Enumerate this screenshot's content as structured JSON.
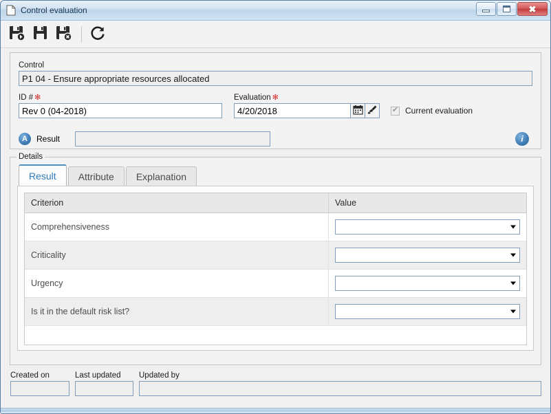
{
  "window": {
    "title": "Control evaluation",
    "icon": "document-icon",
    "buttons": {
      "minimize": "minimize",
      "maximize": "maximize",
      "close": "close"
    }
  },
  "toolbar": {
    "items": [
      {
        "name": "save-new-button",
        "icon": "save-new-icon",
        "tooltip": "Save as new"
      },
      {
        "name": "save-button",
        "icon": "save-icon",
        "tooltip": "Save"
      },
      {
        "name": "save-delete-button",
        "icon": "save-delete-icon",
        "tooltip": "Delete"
      },
      {
        "name": "refresh-button",
        "icon": "refresh-icon",
        "tooltip": "Refresh"
      }
    ]
  },
  "header": {
    "control_label": "Control",
    "control_value": "P1 04 - Ensure appropriate resources allocated",
    "id_label": "ID #",
    "id_required": "✻",
    "id_value": "Rev 0 (04-2018)",
    "evaluation_label": "Evaluation",
    "evaluation_required": "✻",
    "evaluation_value": "4/20/2018",
    "calendar_icon": "calendar-icon",
    "clear_icon": "brush-icon",
    "current_evaluation_label": "Current evaluation",
    "current_evaluation_checked": "✔",
    "result_label": "Result",
    "result_icon_letter": "A",
    "result_value": "",
    "result_placeholder": "",
    "info_icon_letter": "i"
  },
  "details": {
    "legend": "Details",
    "tabs": [
      {
        "label": "Result",
        "active": true
      },
      {
        "label": "Attribute",
        "active": false
      },
      {
        "label": "Explanation",
        "active": false
      }
    ],
    "grid": {
      "columns": [
        "Criterion",
        "Value"
      ],
      "rows": [
        {
          "criterion": "Comprehensiveness",
          "value": ""
        },
        {
          "criterion": "Criticality",
          "value": ""
        },
        {
          "criterion": "Urgency",
          "value": ""
        },
        {
          "criterion": "Is it in the default risk list?",
          "value": ""
        }
      ]
    }
  },
  "footer": {
    "created_on_label": "Created on",
    "created_on_value": "",
    "last_updated_label": "Last updated",
    "last_updated_value": "",
    "updated_by_label": "Updated by",
    "updated_by_value": ""
  },
  "colors": {
    "accent": "#2f7bbf",
    "required": "#d22b2b",
    "title_gradient_start": "#e9f1f8",
    "title_gradient_end": "#cfe2f2",
    "close_button": "#c03d3d"
  }
}
